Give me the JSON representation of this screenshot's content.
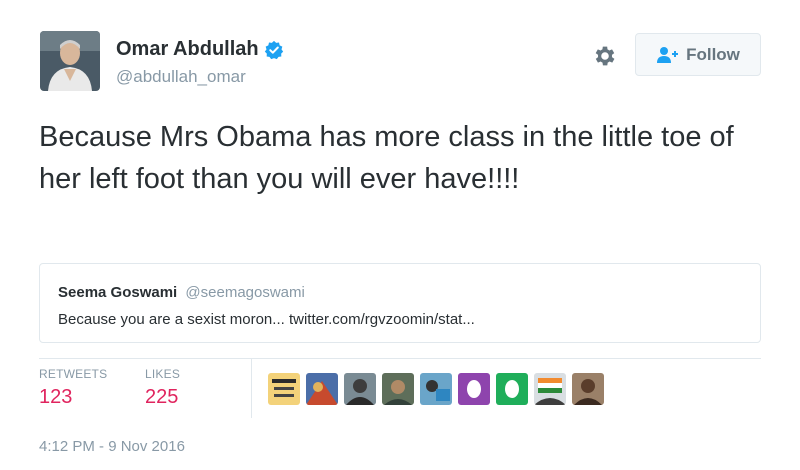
{
  "author": {
    "name": "Omar Abdullah",
    "handle": "@abdullah_omar"
  },
  "actions": {
    "follow_label": "Follow"
  },
  "tweet": {
    "text": "Because Mrs Obama has more class in the little toe of her left foot than you will ever have!!!!"
  },
  "quoted": {
    "name": "Seema Goswami",
    "handle": "@seemagoswami",
    "text": "Because you are a sexist moron... twitter.com/rgvzoomin/stat..."
  },
  "stats": {
    "retweets_label": "RETWEETS",
    "retweets_value": "123",
    "likes_label": "LIKES",
    "likes_value": "225"
  },
  "timestamp": "4:12 PM - 9 Nov 2016",
  "colors": {
    "verified": "#1da1f2",
    "stat_value": "#e0245e",
    "muted": "#8899a6",
    "border": "#e1e8ed"
  }
}
